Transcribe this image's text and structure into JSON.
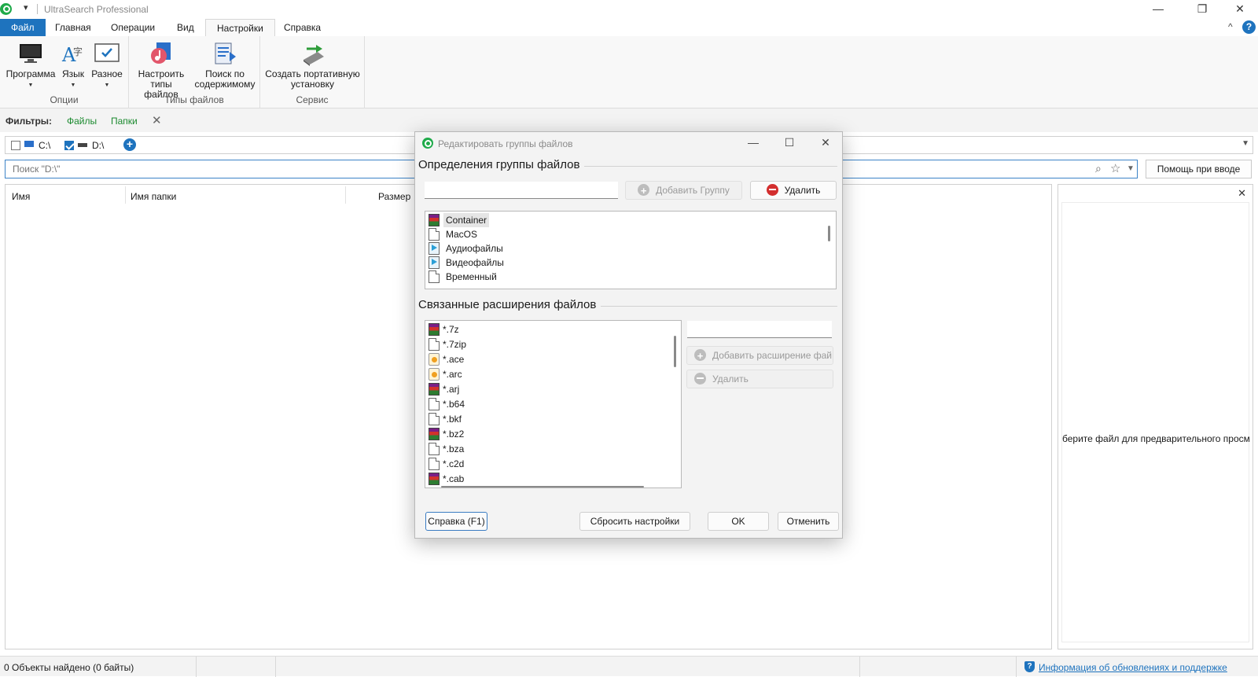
{
  "app": {
    "title": "UltraSearch Professional",
    "window_controls": {
      "minimize": "—",
      "restore": "❐",
      "close": "✕"
    }
  },
  "ribbon_tabs": [
    "Файл",
    "Главная",
    "Операции",
    "Вид",
    "Настройки",
    "Справка"
  ],
  "ribbon_controls": {
    "collapse": "^",
    "help": "?"
  },
  "ribbon": {
    "options_group": {
      "label": "Опции",
      "buttons": [
        "Программа",
        "Язык",
        "Разное"
      ]
    },
    "filetypes_group": {
      "label": "Типы файлов",
      "buttons": [
        {
          "line1": "Настроить",
          "line2": "типы файлов"
        },
        {
          "line1": "Поиск по",
          "line2": "содержимому"
        }
      ]
    },
    "service_group": {
      "label": "Сервис",
      "button": {
        "line1": "Создать портативную",
        "line2": "установку"
      }
    }
  },
  "filters": {
    "label": "Фильтры:",
    "files": "Файлы",
    "folders": "Папки",
    "clear": "✕"
  },
  "drives": [
    {
      "label": "C:\\",
      "checked": false
    },
    {
      "label": "D:\\",
      "checked": true
    }
  ],
  "search": {
    "placeholder": "Поиск \"D:\\\"",
    "help_button": "Помощь при вводе"
  },
  "results": {
    "columns": [
      "Имя",
      "Имя папки",
      "Размер"
    ]
  },
  "preview": {
    "close": "✕",
    "message": "берите файл для предварительного просмо"
  },
  "status": {
    "objects_found": "0 Объекты найдено (0 байты)",
    "update_link": "Информация об обновлениях и поддержке"
  },
  "dialog": {
    "title": "Редактировать группы файлов",
    "section_groups": "Определения группы файлов",
    "group_name_value": "",
    "add_group_button": "Добавить Группу",
    "delete_group_button": "Удалить",
    "groups": [
      {
        "name": "Container",
        "icon": "archive-icon",
        "selected": true
      },
      {
        "name": "MacOS",
        "icon": "document-icon",
        "selected": false
      },
      {
        "name": "Аудиофайлы",
        "icon": "audio-icon",
        "selected": false
      },
      {
        "name": "Видеофайлы",
        "icon": "video-icon",
        "selected": false
      },
      {
        "name": "Временный",
        "icon": "document-icon",
        "selected": false
      }
    ],
    "section_extensions": "Связанные расширения файлов",
    "extensions": [
      {
        "ext": "*.7z",
        "icon": "archive-icon"
      },
      {
        "ext": "*.7zip",
        "icon": "document-icon"
      },
      {
        "ext": "*.ace",
        "icon": "ace-icon"
      },
      {
        "ext": "*.arc",
        "icon": "ace-icon"
      },
      {
        "ext": "*.arj",
        "icon": "archive-icon"
      },
      {
        "ext": "*.b64",
        "icon": "document-icon"
      },
      {
        "ext": "*.bkf",
        "icon": "document-icon"
      },
      {
        "ext": "*.bz2",
        "icon": "archive-icon"
      },
      {
        "ext": "*.bza",
        "icon": "document-icon"
      },
      {
        "ext": "*.c2d",
        "icon": "document-icon"
      },
      {
        "ext": "*.cab",
        "icon": "archive-icon"
      }
    ],
    "extension_input_value": "",
    "add_extension_button": "Добавить расширение фай",
    "delete_extension_button": "Удалить",
    "help_button": "Справка (F1)",
    "reset_button": "Сбросить настройки",
    "ok_button": "OK",
    "cancel_button": "Отменить"
  }
}
